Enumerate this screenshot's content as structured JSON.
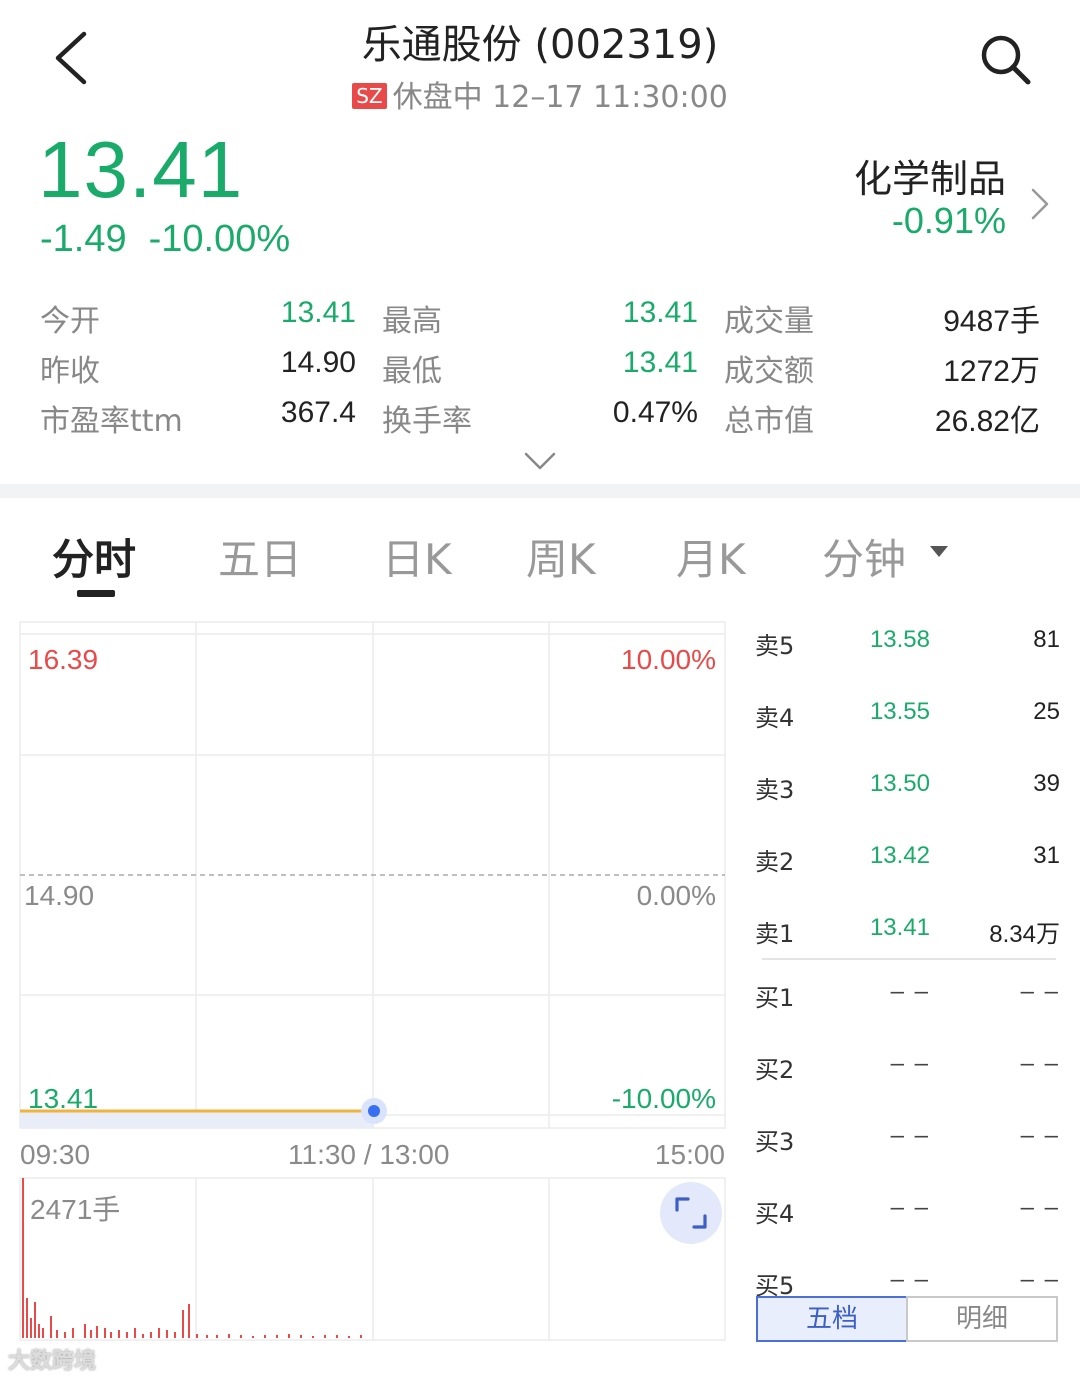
{
  "header": {
    "title": "乐通股份 (002319)",
    "market_badge": "SZ",
    "status": "休盘中 12–17 11:30:00"
  },
  "quote": {
    "price": "13.41",
    "change": "-1.49",
    "change_pct": "-10.00%",
    "sector_name": "化学制品",
    "sector_pct": "-0.91%"
  },
  "stats": [
    {
      "label": "今开",
      "value": "13.41"
    },
    {
      "label": "最高",
      "value": "13.41"
    },
    {
      "label": "成交量",
      "value": "9487手"
    },
    {
      "label": "昨收",
      "value": "14.90"
    },
    {
      "label": "最低",
      "value": "13.41"
    },
    {
      "label": "成交额",
      "value": "1272万"
    },
    {
      "label": "市盈率ttm",
      "value": "367.4"
    },
    {
      "label": "换手率",
      "value": "0.47%"
    },
    {
      "label": "总市值",
      "value": "26.82亿"
    }
  ],
  "tabs": [
    "分时",
    "五日",
    "日K",
    "周K",
    "月K",
    "分钟"
  ],
  "chart": {
    "price_high": "16.39",
    "pct_high": "10.00%",
    "price_prev": "14.90",
    "pct_prev": "0.00%",
    "price_low": "13.41",
    "pct_low": "-10.00%",
    "time_start": "09:30",
    "time_mid": "11:30 / 13:00",
    "time_end": "15:00",
    "volume_label": "2471手"
  },
  "chart_data": {
    "type": "line",
    "x": [
      "09:30",
      "11:30"
    ],
    "series": [
      {
        "values": [
          13.41,
          13.41
        ]
      }
    ],
    "ylim": [
      13.41,
      16.39
    ],
    "grid": true
  },
  "order_book": {
    "sell": [
      {
        "label": "卖5",
        "price": "13.58",
        "volume": "81"
      },
      {
        "label": "卖4",
        "price": "13.55",
        "volume": "25"
      },
      {
        "label": "卖3",
        "price": "13.50",
        "volume": "39"
      },
      {
        "label": "卖2",
        "price": "13.42",
        "volume": "31"
      },
      {
        "label": "卖1",
        "price": "13.41",
        "volume": "8.34万"
      }
    ],
    "buy": [
      {
        "label": "买1",
        "price": "– –",
        "volume": "– –"
      },
      {
        "label": "买2",
        "price": "– –",
        "volume": "– –"
      },
      {
        "label": "买3",
        "price": "– –",
        "volume": "– –"
      },
      {
        "label": "买4",
        "price": "– –",
        "volume": "– –"
      },
      {
        "label": "买5",
        "price": "– –",
        "volume": "– –"
      }
    ],
    "tab_depth": "五档",
    "tab_detail": "明细"
  },
  "watermark": "大数跨境",
  "colors": {
    "down": "#1aab6b",
    "up": "#e84a4a",
    "accent": "#3b5fc6",
    "price_line": "#f0b43c"
  }
}
